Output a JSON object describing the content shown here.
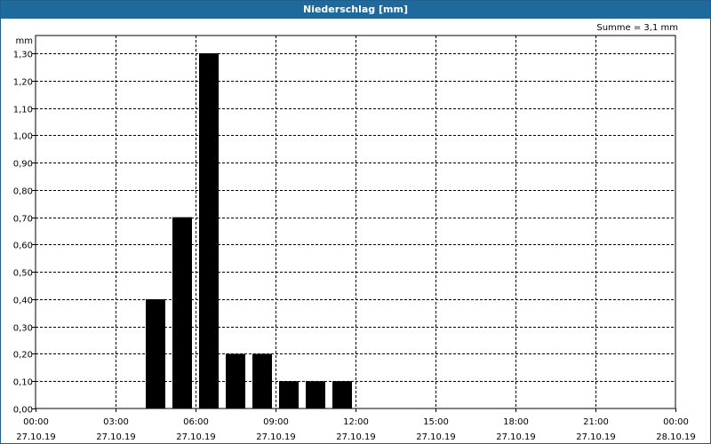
{
  "chart_data": {
    "type": "bar",
    "title": "Niederschlag [mm]",
    "summary": "Summe = 3,1 mm",
    "ylabel": "mm",
    "ylim": [
      0,
      1.3
    ],
    "yticks": [
      "0,00",
      "0,10",
      "0,20",
      "0,30",
      "0,40",
      "0,50",
      "0,60",
      "0,70",
      "0,80",
      "0,90",
      "1,00",
      "1,10",
      "1,20",
      "1,30"
    ],
    "xlim_hours": [
      0,
      24
    ],
    "xticks": [
      {
        "time": "00:00",
        "date": "27.10.19",
        "hour": 0
      },
      {
        "time": "03:00",
        "date": "27.10.19",
        "hour": 3
      },
      {
        "time": "06:00",
        "date": "27.10.19",
        "hour": 6
      },
      {
        "time": "09:00",
        "date": "27.10.19",
        "hour": 9
      },
      {
        "time": "12:00",
        "date": "27.10.19",
        "hour": 12
      },
      {
        "time": "15:00",
        "date": "27.10.19",
        "hour": 15
      },
      {
        "time": "18:00",
        "date": "27.10.19",
        "hour": 18
      },
      {
        "time": "21:00",
        "date": "27.10.19",
        "hour": 21
      },
      {
        "time": "00:00",
        "date": "28.10.19",
        "hour": 24
      }
    ],
    "bars": [
      {
        "start_hour": 4,
        "value": 0.4
      },
      {
        "start_hour": 5,
        "value": 0.7
      },
      {
        "start_hour": 6,
        "value": 1.3
      },
      {
        "start_hour": 7,
        "value": 0.2
      },
      {
        "start_hour": 8,
        "value": 0.2
      },
      {
        "start_hour": 9,
        "value": 0.1
      },
      {
        "start_hour": 10,
        "value": 0.1
      },
      {
        "start_hour": 11,
        "value": 0.1
      }
    ],
    "grid": true,
    "bar_color": "#000000"
  }
}
